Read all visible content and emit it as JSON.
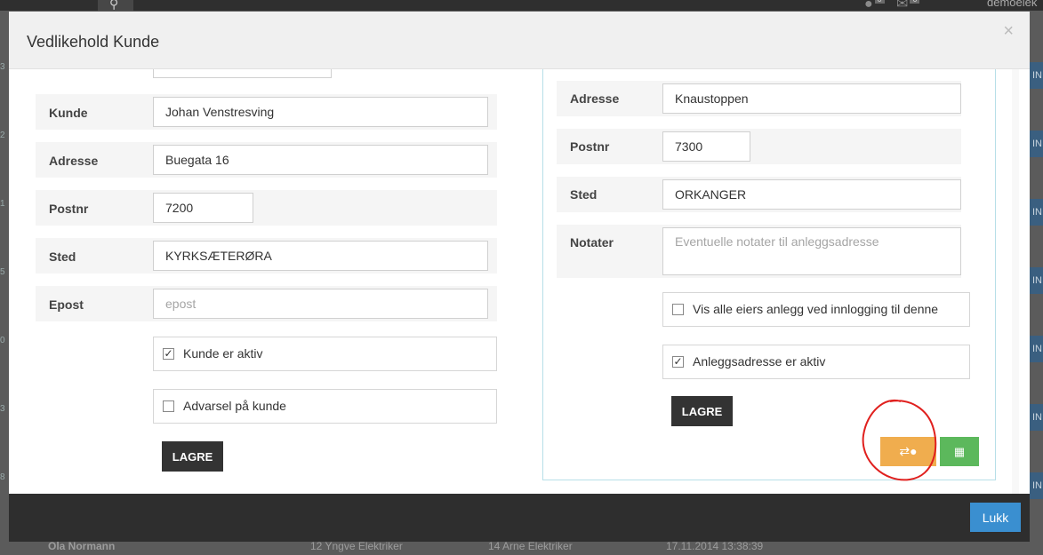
{
  "background": {
    "header_user": "demoelek",
    "notify_count_1": "0",
    "notify_count_2": "0",
    "row_nums": [
      "3",
      "2",
      "1",
      "5",
      "0",
      "3",
      "8"
    ],
    "side_btn": "IN",
    "footer_row": {
      "name": "Ola Normann",
      "col2": "12 Yngve Elektriker",
      "col3": "14 Arne Elektriker",
      "date": "17.11.2014 13:38:39"
    }
  },
  "modal": {
    "title": "Vedlikehold Kunde",
    "close_glyph": "×",
    "close_label": "Lukk"
  },
  "left_form": {
    "kunde": {
      "label": "Kunde",
      "value": "Johan Venstresving"
    },
    "adresse": {
      "label": "Adresse",
      "value": "Buegata 16"
    },
    "postnr": {
      "label": "Postnr",
      "value": "7200"
    },
    "sted": {
      "label": "Sted",
      "value": "KYRKSÆTERØRA"
    },
    "epost": {
      "label": "Epost",
      "value": "",
      "placeholder": "epost"
    },
    "kunde_aktiv": {
      "label": "Kunde er aktiv",
      "checked": true
    },
    "advarsel": {
      "label": "Advarsel på kunde",
      "checked": false
    },
    "save_label": "LAGRE"
  },
  "right_form": {
    "adresse": {
      "label": "Adresse",
      "value": "Knaustoppen"
    },
    "postnr": {
      "label": "Postnr",
      "value": "7300"
    },
    "sted": {
      "label": "Sted",
      "value": "ORKANGER"
    },
    "notater": {
      "label": "Notater",
      "value": "",
      "placeholder": "Eventuelle notater til anleggsadresse"
    },
    "vis_alle": {
      "label": "Vis alle eiers anlegg ved innlogging til denne",
      "checked": false
    },
    "anlegg_aktiv": {
      "label": "Anleggsadresse er aktiv",
      "checked": true
    },
    "save_label": "LAGRE"
  },
  "icons": {
    "transfer_user": "transfer-user-icon",
    "grid": "grid-icon",
    "search": "search-icon",
    "users": "users-icon",
    "mail": "mail-icon"
  },
  "colors": {
    "primary": "#3a8fd0",
    "warning": "#f0ad4e",
    "success": "#5cb85c",
    "dark": "#333333",
    "annotation": "#e0201e"
  }
}
